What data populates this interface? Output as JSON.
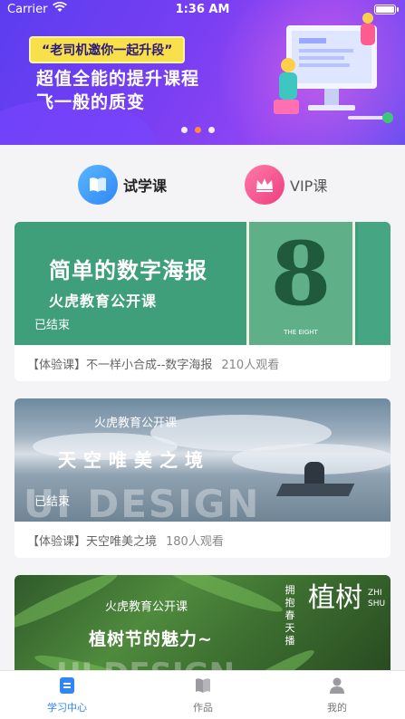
{
  "status_bar": {
    "carrier": "Carrier",
    "time": "1:36 AM"
  },
  "banner": {
    "invite": "“老司机邀你一起升段”",
    "headline_1": "超值全能的提升课程",
    "headline_2": "飞一般的质变",
    "page_indicator": {
      "count": 3,
      "active_index": 1
    }
  },
  "course_tabs": [
    {
      "label": "试学课",
      "icon": "book-open-icon",
      "color": "#2f86f4",
      "selected": true
    },
    {
      "label": "VIP课",
      "icon": "crown-icon",
      "color": "#ee3f7e",
      "selected": false
    }
  ],
  "courses": [
    {
      "thumb_title": "简单的数字海报",
      "thumb_subtitle": "火虎教育公开课",
      "poster_number": "8",
      "poster_caption": "THE EIGHT",
      "status": "已结束",
      "label": "【体验课】不一样小合成--数字海报",
      "views": "210人观看"
    },
    {
      "thumb_subtitle": "火虎教育公开课",
      "thumb_title": "天空唯美之境",
      "ghost_text": "UI DESIGN",
      "status": "已结束",
      "label": "【体验课】天空唯美之境",
      "views": "180人观看"
    },
    {
      "thumb_subtitle": "火虎教育公开课",
      "thumb_title": "植树节的魅力~",
      "ghost_text": "UI DESIGN",
      "vertical_big": "植树",
      "vertical_small": "拥抱春天播",
      "vertical_latin": "ZHI SHU"
    }
  ],
  "tabbar": [
    {
      "label": "学习中心",
      "icon": "study-icon",
      "active": true
    },
    {
      "label": "作品",
      "icon": "works-book-icon",
      "active": false
    },
    {
      "label": "我的",
      "icon": "profile-icon",
      "active": false
    }
  ],
  "colors": {
    "accent": "#2f86f4",
    "vip": "#ee3f7e",
    "banner_gradient_start": "#5a3df0",
    "banner_gradient_end": "#8f45f4"
  }
}
